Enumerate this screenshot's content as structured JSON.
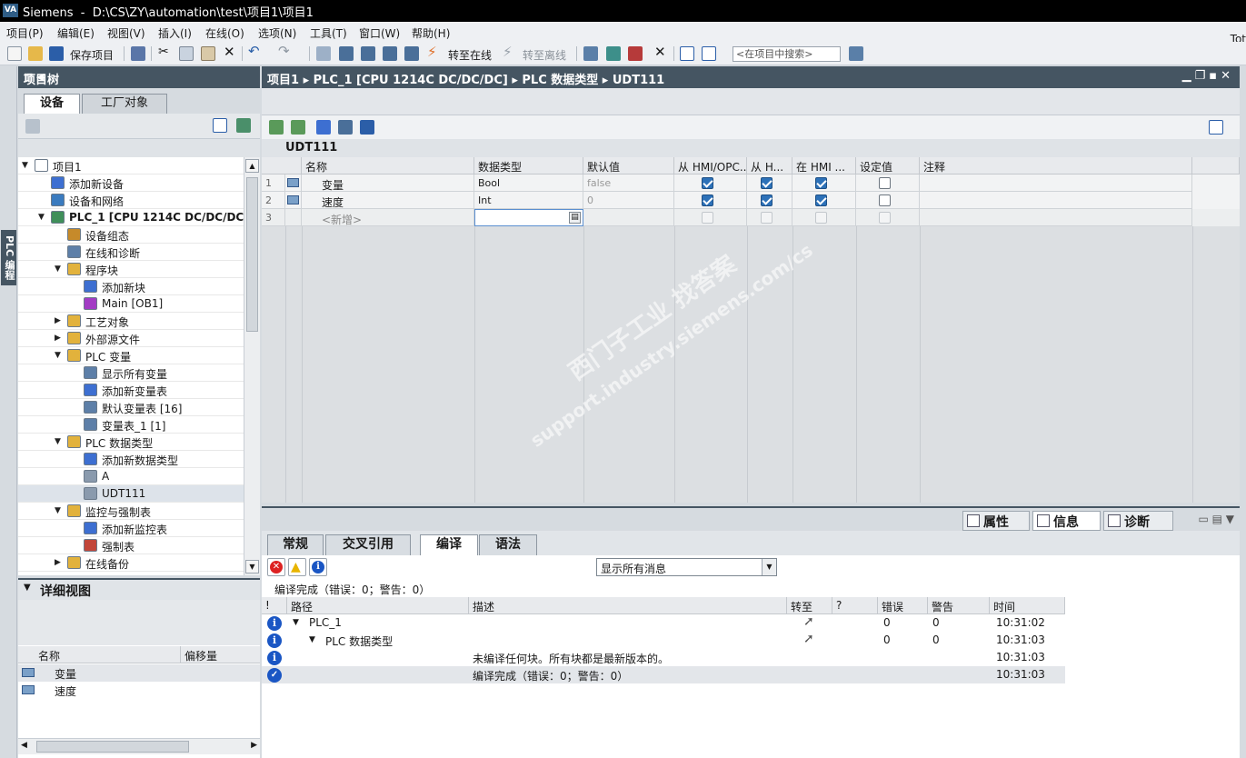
{
  "title_bar": {
    "app": "Siemens",
    "path": "D:\\CS\\ZY\\automation\\test\\项目1\\项目1"
  },
  "menu": [
    "项目(P)",
    "编辑(E)",
    "视图(V)",
    "插入(I)",
    "在线(O)",
    "选项(N)",
    "工具(T)",
    "窗口(W)",
    "帮助(H)"
  ],
  "menu_right": "Tot",
  "toolbar": {
    "save_label": "保存项目",
    "go_online": "转至在线",
    "go_offline": "转至离线",
    "search_placeholder": "<在项目中搜索>"
  },
  "left_strip_label": "PLC 编程",
  "project_tree": {
    "title": "项目树",
    "tab_devices": "设备",
    "tab_plant": "工厂对象",
    "items": [
      {
        "label": "项目1",
        "indent": 0,
        "arrow": "▼",
        "color": "#ffffff"
      },
      {
        "label": "添加新设备",
        "indent": 1,
        "arrow": "",
        "color": "#3d6fd1"
      },
      {
        "label": "设备和网络",
        "indent": 1,
        "arrow": "",
        "color": "#3a7bbf"
      },
      {
        "label": "PLC_1 [CPU 1214C DC/DC/DC]",
        "indent": 1,
        "arrow": "▼",
        "color": "#3f8f5a",
        "bold": true
      },
      {
        "label": "设备组态",
        "indent": 2,
        "arrow": "",
        "color": "#c68a2a"
      },
      {
        "label": "在线和诊断",
        "indent": 2,
        "arrow": "",
        "color": "#5d7fa8"
      },
      {
        "label": "程序块",
        "indent": 2,
        "arrow": "▼",
        "color": "#e2b23c"
      },
      {
        "label": "添加新块",
        "indent": 3,
        "arrow": "",
        "color": "#3d6fd1"
      },
      {
        "label": "Main [OB1]",
        "indent": 3,
        "arrow": "",
        "color": "#a23cc4"
      },
      {
        "label": "工艺对象",
        "indent": 2,
        "arrow": "▶",
        "color": "#e2b23c"
      },
      {
        "label": "外部源文件",
        "indent": 2,
        "arrow": "▶",
        "color": "#e2b23c"
      },
      {
        "label": "PLC 变量",
        "indent": 2,
        "arrow": "▼",
        "color": "#e2b23c"
      },
      {
        "label": "显示所有变量",
        "indent": 3,
        "arrow": "",
        "color": "#5d7fa8"
      },
      {
        "label": "添加新变量表",
        "indent": 3,
        "arrow": "",
        "color": "#3d6fd1"
      },
      {
        "label": "默认变量表 [16]",
        "indent": 3,
        "arrow": "",
        "color": "#5d7fa8"
      },
      {
        "label": "变量表_1 [1]",
        "indent": 3,
        "arrow": "",
        "color": "#5d7fa8"
      },
      {
        "label": "PLC 数据类型",
        "indent": 2,
        "arrow": "▼",
        "color": "#e2b23c"
      },
      {
        "label": "添加新数据类型",
        "indent": 3,
        "arrow": "",
        "color": "#3d6fd1"
      },
      {
        "label": "A",
        "indent": 3,
        "arrow": "",
        "color": "#8a9aad"
      },
      {
        "label": "UDT111",
        "indent": 3,
        "arrow": "",
        "color": "#8a9aad",
        "selected": true
      },
      {
        "label": "监控与强制表",
        "indent": 2,
        "arrow": "▼",
        "color": "#e2b23c"
      },
      {
        "label": "添加新监控表",
        "indent": 3,
        "arrow": "",
        "color": "#3d6fd1"
      },
      {
        "label": "强制表",
        "indent": 3,
        "arrow": "",
        "color": "#c2463a"
      },
      {
        "label": "在线备份",
        "indent": 2,
        "arrow": "▶",
        "color": "#e2b23c"
      }
    ]
  },
  "detail_view": {
    "title": "详细视图",
    "col_name": "名称",
    "col_offset": "偏移量",
    "rows": [
      "变量",
      "速度"
    ]
  },
  "editor": {
    "breadcrumb": "项目1  ▸  PLC_1 [CPU 1214C DC/DC/DC]  ▸  PLC 数据类型  ▸  UDT111",
    "udt_name": "UDT111",
    "columns": [
      "名称",
      "数据类型",
      "默认值",
      "从 HMI/OPC...",
      "从 H...",
      "在 HMI ...",
      "设定值",
      "注释"
    ],
    "rows": [
      {
        "num": "1",
        "name": "变量",
        "type": "Bool",
        "default": "false",
        "hmi1": true,
        "hmi2": true,
        "hmi3": true,
        "setpoint": false
      },
      {
        "num": "2",
        "name": "速度",
        "type": "Int",
        "default": "0",
        "hmi1": true,
        "hmi2": true,
        "hmi3": true,
        "setpoint": false
      },
      {
        "num": "3",
        "name": "<新增>",
        "type": "",
        "default": "",
        "hmi1": false,
        "hmi2": false,
        "hmi3": false,
        "setpoint": false
      }
    ],
    "watermark_line1": "西门子工业    找答案",
    "watermark_line2": "support.industry.siemens.com/cs"
  },
  "inspector": {
    "tab_properties": "属性",
    "tab_info": "信息",
    "tab_diagnostics": "诊断",
    "subtabs": [
      "常规",
      "交叉引用",
      "编译",
      "语法"
    ],
    "filter_value": "显示所有消息",
    "status": "编译完成（错误：0；警告：0）",
    "columns": [
      "!",
      "路径",
      "描述",
      "转至",
      "?",
      "错误",
      "警告",
      "时间"
    ],
    "messages": [
      {
        "path": "PLC_1",
        "indent": 0,
        "arrow": "▼",
        "desc": "",
        "goto": true,
        "errors": "0",
        "warnings": "0",
        "time": "10:31:02",
        "kind": "info"
      },
      {
        "path": "PLC 数据类型",
        "indent": 1,
        "arrow": "▼",
        "desc": "",
        "goto": true,
        "errors": "0",
        "warnings": "0",
        "time": "10:31:03",
        "kind": "info"
      },
      {
        "path": "",
        "indent": 0,
        "arrow": "",
        "desc": "未编译任何块。所有块都是最新版本的。",
        "goto": false,
        "errors": "",
        "warnings": "",
        "time": "10:31:03",
        "kind": "info"
      },
      {
        "path": "",
        "indent": 0,
        "arrow": "",
        "desc": "编译完成（错误：0；警告：0）",
        "goto": false,
        "errors": "",
        "warnings": "",
        "time": "10:31:03",
        "kind": "ok"
      }
    ]
  }
}
